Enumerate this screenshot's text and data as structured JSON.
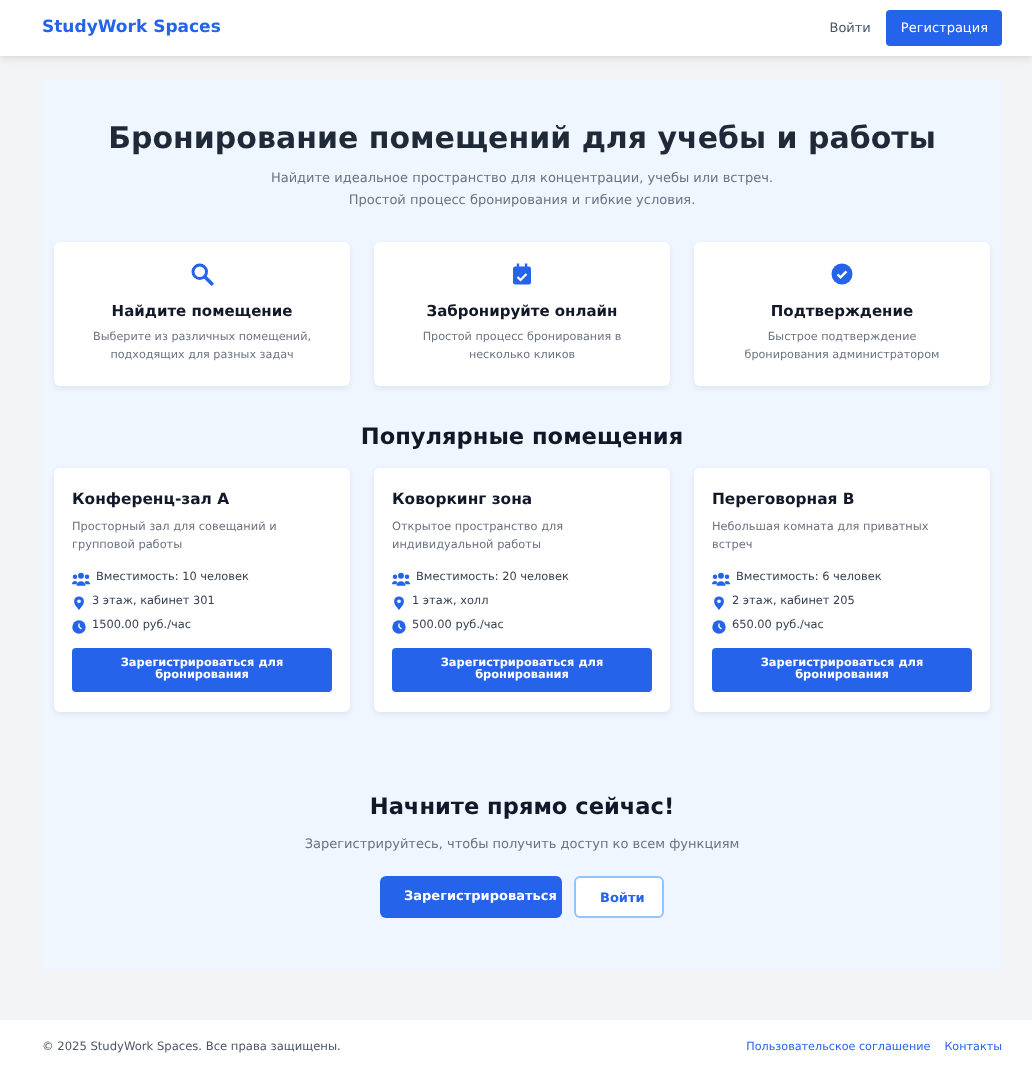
{
  "header": {
    "logo": "StudyWork Spaces",
    "login": "Войти",
    "register": "Регистрация"
  },
  "hero": {
    "title": "Бронирование помещений для учебы и работы",
    "subtitle_lines": [
      "Найдите идеальное пространство для концентрации, учебы или встреч.",
      "Простой процесс бронирования и гибкие условия."
    ]
  },
  "features": [
    {
      "kind": "search",
      "title": "Найдите помещение",
      "text": "Выберите из различных помещений, подходящих для разных задач"
    },
    {
      "kind": "calendar",
      "title": "Забронируйте онлайн",
      "text": "Простой процесс бронирования в несколько кликов"
    },
    {
      "kind": "check",
      "title": "Подтверждение",
      "text": "Быстрое подтверждение бронирования администратором"
    }
  ],
  "popular": {
    "title": "Популярные помещения",
    "rooms": [
      {
        "name": "Конференц-зал А",
        "description": "Просторный зал для совещаний и групповой работы",
        "details": [
          {
            "kind": "capacity",
            "text": "Вместимость: 10 человек"
          },
          {
            "kind": "location",
            "text": "3 этаж, кабинет 301"
          },
          {
            "kind": "price",
            "text": "1500.00 руб./час"
          }
        ],
        "button": "Зарегистрироваться для бронирования"
      },
      {
        "name": "Коворкинг зона",
        "description": "Открытое пространство для индивидуальной работы",
        "details": [
          {
            "kind": "capacity",
            "text": "Вместимость: 20 человек"
          },
          {
            "kind": "location",
            "text": "1 этаж, холл"
          },
          {
            "kind": "price",
            "text": "500.00 руб./час"
          }
        ],
        "button": "Зарегистрироваться для бронирования"
      },
      {
        "name": "Переговорная B",
        "description": "Небольшая комната для приватных встреч",
        "details": [
          {
            "kind": "capacity",
            "text": "Вместимость: 6 человек"
          },
          {
            "kind": "location",
            "text": "2 этаж, кабинет 205"
          },
          {
            "kind": "price",
            "text": "650.00 руб./час"
          }
        ],
        "button": "Зарегистрироваться для бронирования"
      }
    ]
  },
  "cta": {
    "title": "Начните прямо сейчас!",
    "text": "Зарегистрируйтесь, чтобы получить доступ ко всем функциям",
    "primary": "Зарегистрироваться",
    "secondary": "Войти"
  },
  "footer": {
    "copyright": "© 2025 StudyWork Spaces. Все права защищены.",
    "links": [
      "Пользовательское соглашение",
      "Контакты"
    ]
  }
}
